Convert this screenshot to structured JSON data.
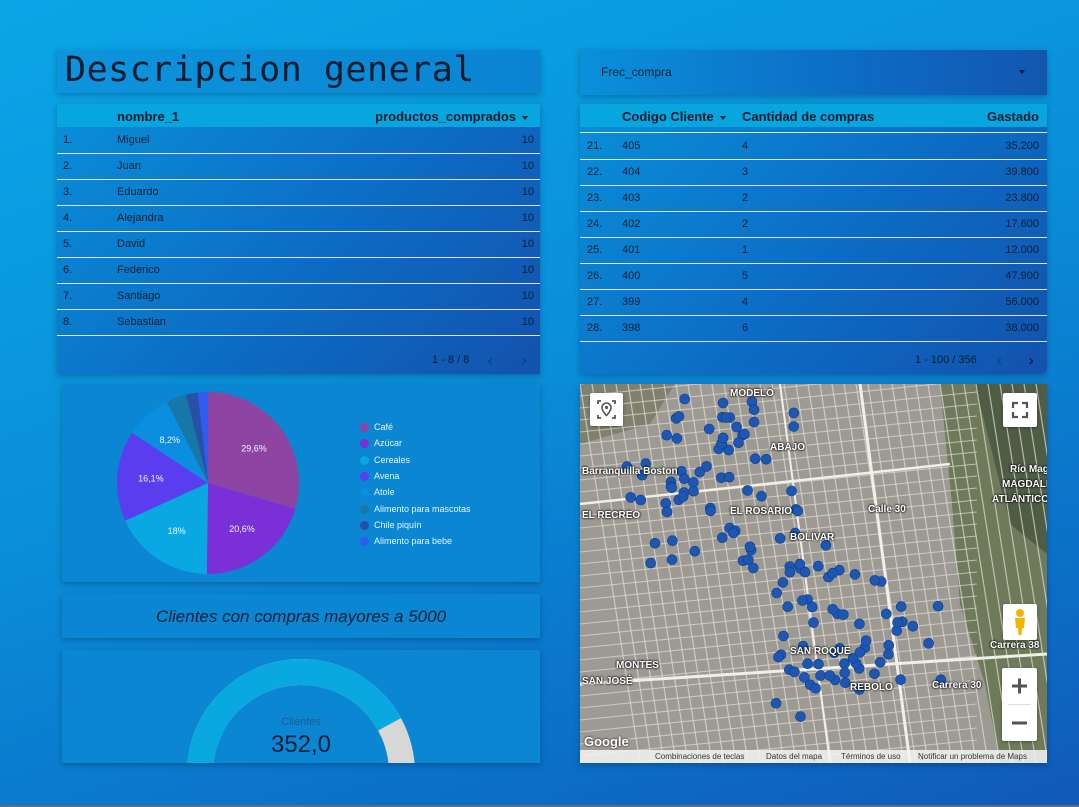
{
  "title": "Descripcion general",
  "dropdown": {
    "label": "Frec_compra"
  },
  "table_left": {
    "columns": [
      "nombre_1",
      "productos_comprados"
    ],
    "rows": [
      {
        "index": "1.",
        "name": "Miguel",
        "value": "10"
      },
      {
        "index": "2.",
        "name": "Juan",
        "value": "10"
      },
      {
        "index": "3.",
        "name": "Eduardo",
        "value": "10"
      },
      {
        "index": "4.",
        "name": "Alejandra",
        "value": "10"
      },
      {
        "index": "5.",
        "name": "David",
        "value": "10"
      },
      {
        "index": "6.",
        "name": "Federico",
        "value": "10"
      },
      {
        "index": "7.",
        "name": "Santiago",
        "value": "10"
      },
      {
        "index": "8.",
        "name": "Sebastian",
        "value": "10"
      }
    ],
    "pagination": "1 - 8 / 8",
    "prev_icon": "chevron-left-icon",
    "next_icon": "chevron-right-icon"
  },
  "table_right": {
    "columns": [
      "Codigo Cliente",
      "Cantidad de compras",
      "Gastado"
    ],
    "rows": [
      {
        "index": "21.",
        "code": "405",
        "count": "4",
        "spent": "35.200"
      },
      {
        "index": "22.",
        "code": "404",
        "count": "3",
        "spent": "39.800"
      },
      {
        "index": "23.",
        "code": "403",
        "count": "2",
        "spent": "23.800"
      },
      {
        "index": "24.",
        "code": "402",
        "count": "2",
        "spent": "17.600"
      },
      {
        "index": "25.",
        "code": "401",
        "count": "1",
        "spent": "12.000"
      },
      {
        "index": "26.",
        "code": "400",
        "count": "5",
        "spent": "47.900"
      },
      {
        "index": "27.",
        "code": "399",
        "count": "4",
        "spent": "56.000"
      },
      {
        "index": "28.",
        "code": "398",
        "count": "6",
        "spent": "38.000"
      }
    ],
    "pagination": "1 - 100 / 356"
  },
  "chart_data": {
    "type": "pie",
    "title": "",
    "slices": [
      {
        "label": "Café",
        "value": 29.6,
        "color": "#8e44a3",
        "display": "29,6%"
      },
      {
        "label": "Azúcar",
        "value": 20.6,
        "color": "#7b2fd6",
        "display": "20,6%"
      },
      {
        "label": "Cereales",
        "value": 18.0,
        "color": "#0aa8e3",
        "display": "18%"
      },
      {
        "label": "Avena",
        "value": 16.1,
        "color": "#5b3df0",
        "display": "16,1%"
      },
      {
        "label": "Atole",
        "value": 8.2,
        "color": "#0b8ee0",
        "display": "8,2%"
      },
      {
        "label": "Alimento para mascotas",
        "value": 3.6,
        "color": "#1778a8",
        "display": ""
      },
      {
        "label": "Chile piquín",
        "value": 2.1,
        "color": "#2850a6",
        "display": ""
      },
      {
        "label": "Alimento para bebe",
        "value": 1.8,
        "color": "#2f5bef",
        "display": ""
      }
    ],
    "legend_position": "right"
  },
  "banner": {
    "text": "Clientes con compras mayores a 5000"
  },
  "gauge": {
    "label": "Clientes",
    "value": "352,0",
    "fill_fraction": 0.84,
    "fill_color": "#09a8e0",
    "track_color": "#d7d7d7"
  },
  "map": {
    "labels": [
      "MODELO",
      "EL ROSARIO",
      "BOLIVAR",
      "EL RECREO",
      "MONTES",
      "SAN JOSÉ",
      "MAGDALENA",
      "ATLÁNTICO",
      "Carrera 30",
      "Carrera 38",
      "Calle 30",
      "Barranquilla Boston",
      "ABAJO",
      "SAN ROQUE",
      "REBOLO",
      "Río Mag"
    ],
    "google": "Google",
    "footer": [
      "Combinaciones de teclas",
      "Datos del mapa",
      "Términos de uso",
      "Notificar un problema de Maps"
    ],
    "marker_color": "#1d57b3",
    "icons": {
      "location": "location-pin-icon",
      "fullscreen": "fullscreen-icon",
      "pegman": "pegman-icon",
      "zoom_in": "plus-icon",
      "zoom_out": "minus-icon"
    }
  }
}
